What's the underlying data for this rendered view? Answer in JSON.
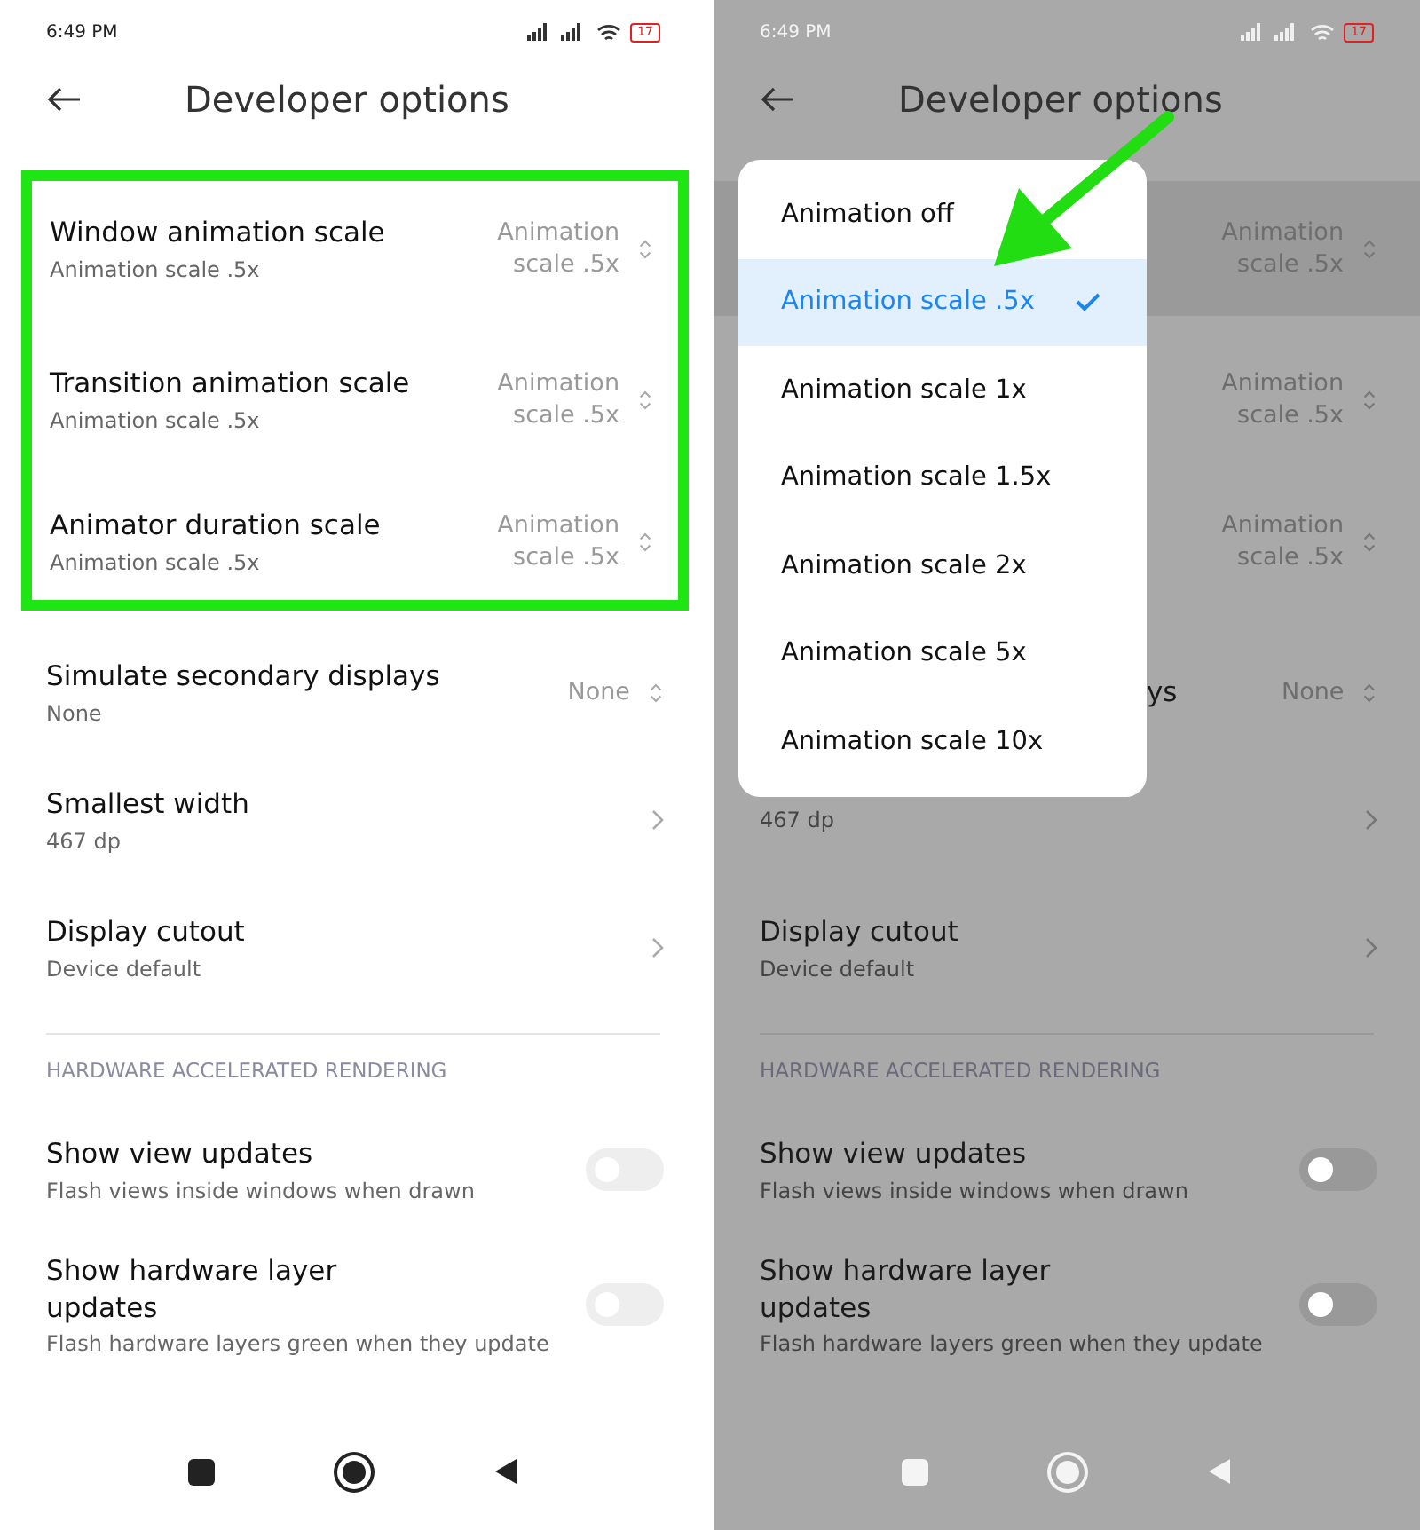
{
  "phones": [
    {
      "dimmed": false,
      "status": {
        "time": "6:49 PM",
        "battery": "17"
      },
      "title": "Developer options",
      "rows": [
        {
          "kind": "select",
          "title": "Window animation scale",
          "summary": "Animation scale .5x",
          "value": "Animation scale .5x",
          "highlighted": false
        },
        {
          "kind": "select",
          "title": "Transition animation scale",
          "summary": "Animation scale .5x",
          "value": "Animation scale .5x",
          "highlighted": false
        },
        {
          "kind": "select",
          "title": "Animator duration scale",
          "summary": "Animation scale .5x",
          "value": "Animation scale .5x",
          "highlighted": false
        },
        {
          "kind": "select",
          "title": "Simulate secondary displays",
          "summary": "None",
          "value": "None",
          "highlighted": false
        },
        {
          "kind": "link",
          "title": "Smallest width",
          "summary": "467 dp"
        },
        {
          "kind": "link",
          "title": "Display cutout",
          "summary": "Device default"
        },
        {
          "kind": "section",
          "label": "HARDWARE ACCELERATED RENDERING"
        },
        {
          "kind": "toggle",
          "title": "Show view updates",
          "summary": "Flash views inside windows when drawn",
          "on": false
        },
        {
          "kind": "toggle",
          "title": "Show hardware layer updates",
          "summary": "Flash hardware layers green when they update",
          "on": false
        }
      ]
    },
    {
      "dimmed": true,
      "status": {
        "time": "6:49 PM",
        "battery": "17"
      },
      "title": "Developer options",
      "rows": [
        {
          "kind": "select",
          "value": "Animation scale .5x",
          "highlighted": true
        },
        {
          "kind": "select",
          "value": "Animation scale .5x",
          "highlighted": false
        },
        {
          "kind": "select",
          "value": "Animation scale .5x",
          "highlighted": false
        },
        {
          "kind": "select",
          "title": "ys",
          "value": "None",
          "highlighted": false
        },
        {
          "kind": "link",
          "summary": "467 dp"
        },
        {
          "kind": "link",
          "title": "Display cutout",
          "summary": "Device default"
        },
        {
          "kind": "section",
          "label": "HARDWARE ACCELERATED RENDERING"
        },
        {
          "kind": "toggle",
          "title": "Show view updates",
          "summary": "Flash views inside windows when drawn",
          "on": false
        },
        {
          "kind": "toggle",
          "title": "Show hardware layer updates",
          "summary": "Flash hardware layers green when they update",
          "on": false
        }
      ],
      "menu": [
        {
          "label": "Animation off",
          "selected": false
        },
        {
          "label": "Animation scale .5x",
          "selected": true
        },
        {
          "label": "Animation scale 1x",
          "selected": false
        },
        {
          "label": "Animation scale 1.5x",
          "selected": false
        },
        {
          "label": "Animation scale 2x",
          "selected": false
        },
        {
          "label": "Animation scale 5x",
          "selected": false
        },
        {
          "label": "Animation scale 10x",
          "selected": false
        }
      ]
    }
  ]
}
